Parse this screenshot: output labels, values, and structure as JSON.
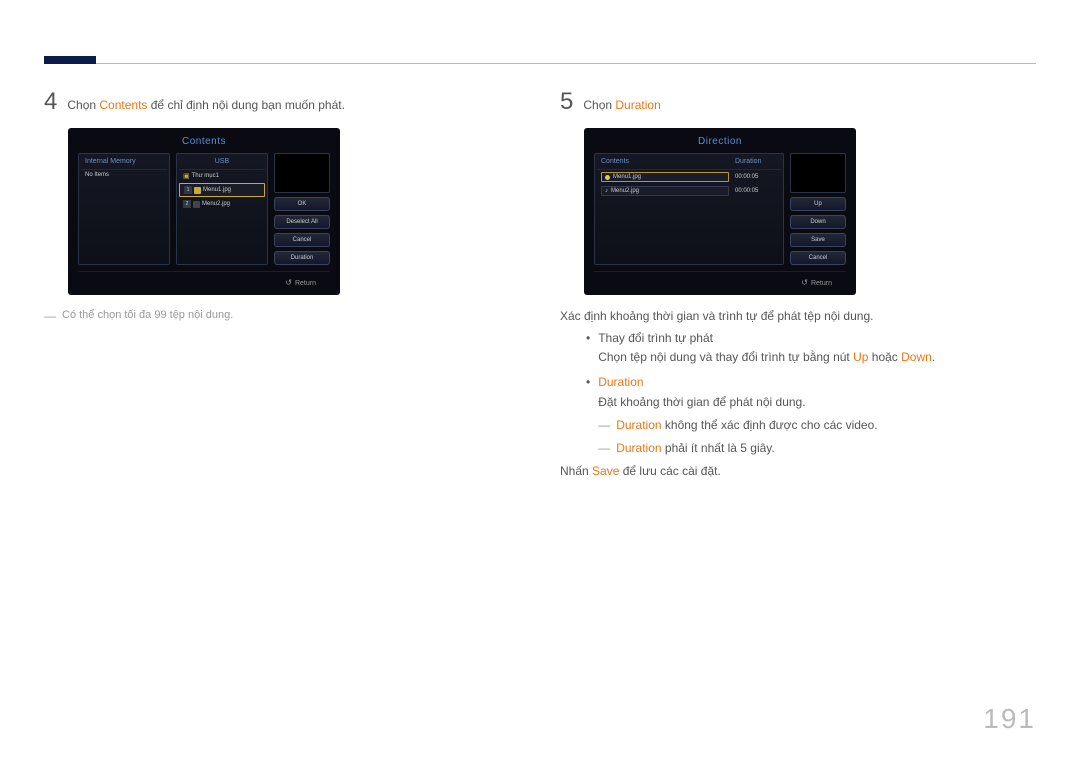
{
  "page_number": "191",
  "left": {
    "step_num": "4",
    "step_prefix": "Chọn ",
    "step_kw": "Contents",
    "step_suffix": " để chỉ định nội dung bạn muốn phát.",
    "note": "Có thể chọn tối đa 99 tệp nội dung.",
    "panel": {
      "title": "Contents",
      "col_a": "Internal Memory",
      "col_a_item": "No Items",
      "col_b": "USB",
      "folder": "Thư mục1",
      "file1": "Menu1.jpg",
      "file2": "Menu2.jpg",
      "btn_ok": "OK",
      "btn_deselect": "Deselect All",
      "btn_cancel": "Cancel",
      "btn_duration": "Duration",
      "return": "Return"
    }
  },
  "right": {
    "step_num": "5",
    "step_prefix": "Chọn ",
    "step_kw": "Duration",
    "panel": {
      "title": "Direction",
      "h_contents": "Contents",
      "h_duration": "Duration",
      "file1": "Menu1.jpg",
      "dur1": "00:00:05",
      "file2": "Menu2.jpg",
      "dur2": "00:00:05",
      "btn_up": "Up",
      "btn_down": "Down",
      "btn_save": "Save",
      "btn_cancel": "Cancel",
      "return": "Return"
    },
    "desc1": "Xác định khoảng thời gian và trình tự để phát tệp nội dung.",
    "b1_title": "Thay đổi trình tự phát",
    "b1_body_a": "Chọn tệp nội dung và thay đổi trình tự bằng nút ",
    "b1_up": "Up",
    "b1_or": " hoặc ",
    "b1_down": "Down",
    "b1_period": ".",
    "b2_title": "Duration",
    "b2_body": "Đặt khoảng thời gian để phát nội dung.",
    "sub1_kw": "Duration",
    "sub1_rest": " không thể xác định được cho các video.",
    "sub2_kw": "Duration",
    "sub2_rest": " phải ít nhất là 5 giây.",
    "tail_a": "Nhấn ",
    "tail_kw": "Save",
    "tail_b": " để lưu các cài đặt."
  }
}
